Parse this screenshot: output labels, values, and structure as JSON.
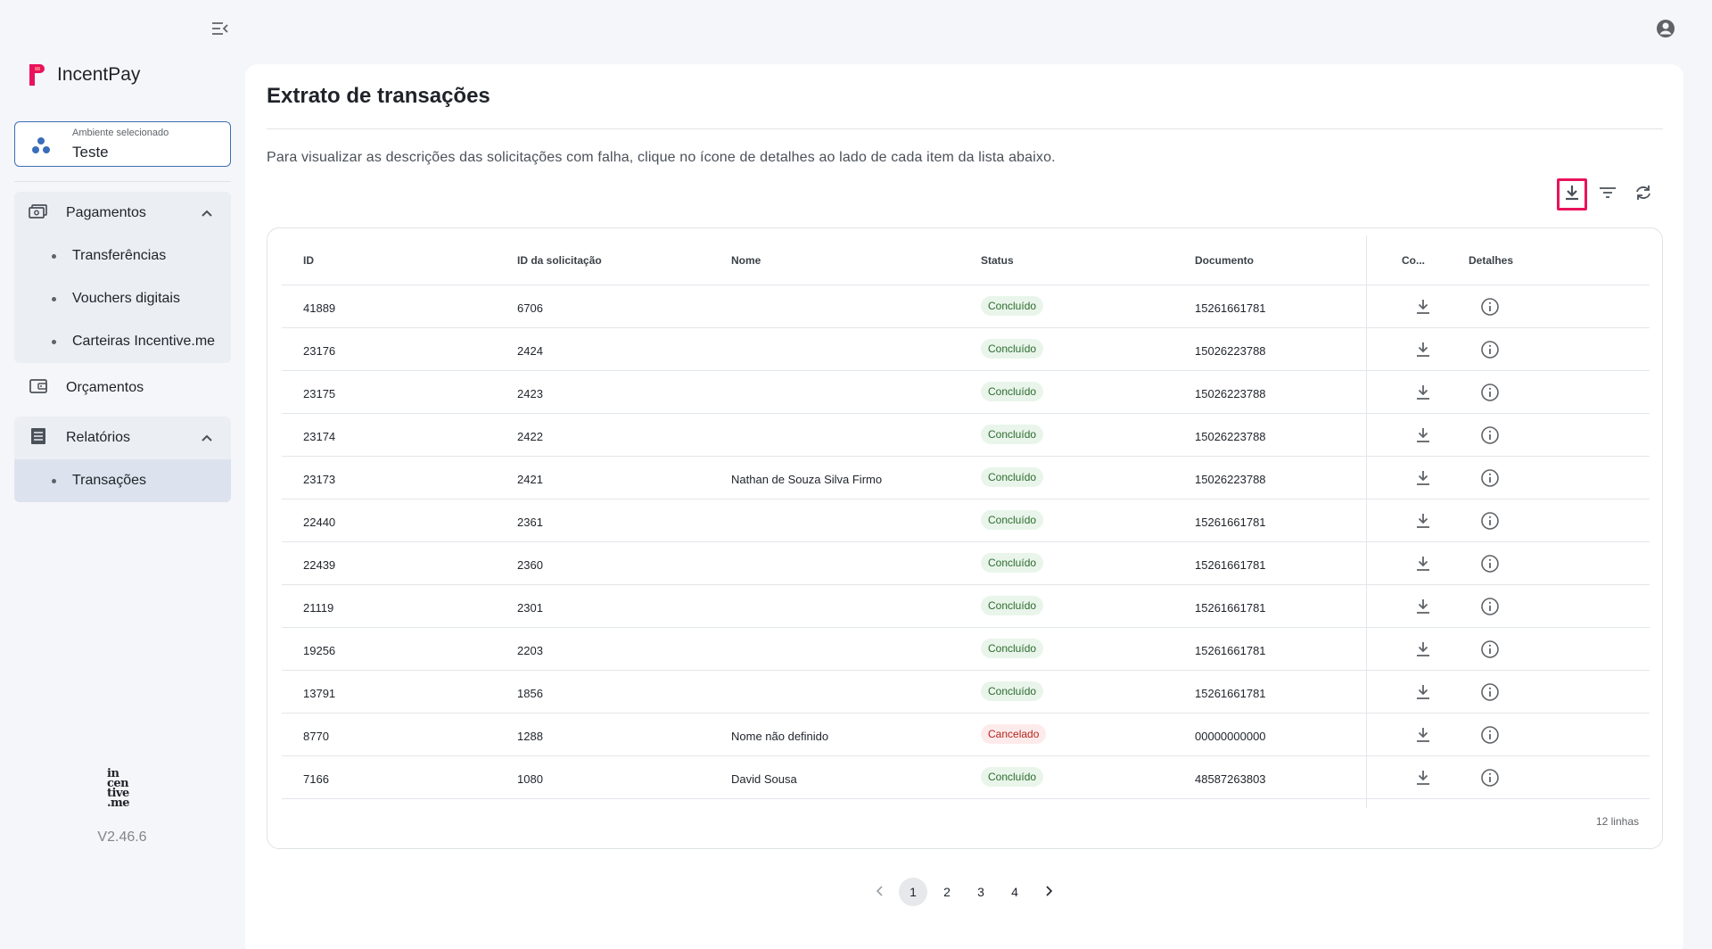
{
  "app": {
    "name": "IncentPay",
    "version": "V2.46.6",
    "bottom_logo_text": "incentive.me"
  },
  "environment": {
    "label": "Ambiente selecionado",
    "value": "Teste"
  },
  "nav": {
    "pagamentos": {
      "label": "Pagamentos",
      "items": [
        "Transferências",
        "Vouchers digitais",
        "Carteiras Incentive.me"
      ]
    },
    "orcamentos": {
      "label": "Orçamentos"
    },
    "relatorios": {
      "label": "Relatórios",
      "items": [
        "Transações"
      ]
    }
  },
  "page": {
    "title": "Extrato de transações",
    "description": "Para visualizar as descrições das solicitações com falha, clique no ícone de detalhes ao lado de cada item da lista abaixo."
  },
  "toolbar": {
    "icons": [
      "download-icon",
      "filter-icon",
      "refresh-icon"
    ]
  },
  "table": {
    "columns": [
      "ID",
      "ID da solicitação",
      "Nome",
      "Status",
      "Documento",
      "Co...",
      "Detalhes"
    ],
    "rows": [
      {
        "id": "41889",
        "request_id": "6706",
        "name": "",
        "status": "Concluído",
        "document": "15261661781"
      },
      {
        "id": "23176",
        "request_id": "2424",
        "name": "",
        "status": "Concluído",
        "document": "15026223788"
      },
      {
        "id": "23175",
        "request_id": "2423",
        "name": "",
        "status": "Concluído",
        "document": "15026223788"
      },
      {
        "id": "23174",
        "request_id": "2422",
        "name": "",
        "status": "Concluído",
        "document": "15026223788"
      },
      {
        "id": "23173",
        "request_id": "2421",
        "name": "Nathan de Souza Silva Firmo",
        "status": "Concluído",
        "document": "15026223788"
      },
      {
        "id": "22440",
        "request_id": "2361",
        "name": "",
        "status": "Concluído",
        "document": "15261661781"
      },
      {
        "id": "22439",
        "request_id": "2360",
        "name": "",
        "status": "Concluído",
        "document": "15261661781"
      },
      {
        "id": "21119",
        "request_id": "2301",
        "name": "",
        "status": "Concluído",
        "document": "15261661781"
      },
      {
        "id": "19256",
        "request_id": "2203",
        "name": "",
        "status": "Concluído",
        "document": "15261661781"
      },
      {
        "id": "13791",
        "request_id": "1856",
        "name": "",
        "status": "Concluído",
        "document": "15261661781"
      },
      {
        "id": "8770",
        "request_id": "1288",
        "name": "Nome não definido",
        "status": "Cancelado",
        "document": "00000000000"
      },
      {
        "id": "7166",
        "request_id": "1080",
        "name": "David Sousa",
        "status": "Concluído",
        "document": "48587263803"
      }
    ],
    "row_count_label": "12 linhas"
  },
  "pagination": {
    "pages": [
      "1",
      "2",
      "3",
      "4"
    ],
    "current": "1"
  },
  "colors": {
    "accent": "#3a6db9",
    "highlight": "#e8135c",
    "success_bg": "#e9f5ea",
    "success_fg": "#2c6b2f",
    "danger_bg": "#fdebec",
    "danger_fg": "#b3261e"
  }
}
